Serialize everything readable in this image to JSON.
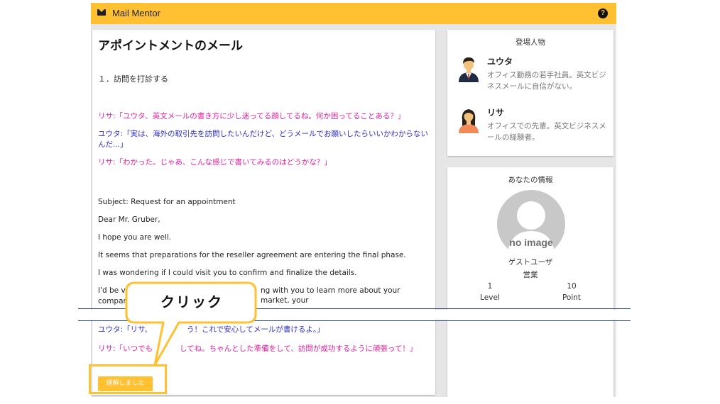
{
  "header": {
    "title": "Mail Mentor",
    "help_glyph": "?"
  },
  "main": {
    "title": "アポイントメントのメール",
    "section": "１．訪問を打診する",
    "dialogue_top": [
      {
        "speaker": "risa",
        "text": "リサ:「ユウタ、英文メールの書き方に少し迷ってる顔してるね。何か困ってることある？」"
      },
      {
        "speaker": "yuta",
        "text": "ユウタ:「実は、海外の取引先を訪問したいんだけど、どうメールでお願いしたらいいかわからないんだ...」"
      },
      {
        "speaker": "risa",
        "text": "リサ:「わかった。じゃあ、こんな感じで書いてみるのはどうかな？」"
      }
    ],
    "email_lines": [
      "Subject: Request for an appointment",
      "Dear Mr. Gruber,",
      "I hope you are well.",
      "It seems that preparations for the reseller agreement are entering the final phase.",
      "I was wondering if I could visit you to confirm and finalize the details.",
      "I'd be very",
      "ng with you to learn more about your market, your",
      "company"
    ],
    "dialogue_bottom": [
      {
        "speaker": "yuta",
        "text": "ユウタ:「リサ、",
        "rest": "う！これで安心してメールが書けるよ。」"
      },
      {
        "speaker": "risa",
        "text": "リサ:「いつでも",
        "rest": "してね。ちゃんとした準備をして、訪問が成功するように頑張って！」"
      }
    ],
    "understood_label": "理解しました"
  },
  "characters": {
    "heading": "登場人物",
    "items": [
      {
        "name": "ユウタ",
        "desc": "オフィス勤務の若手社員。英文ビジネスメールに自信がない。"
      },
      {
        "name": "リサ",
        "desc": "オフィスでの先輩。英文ビジネスメールの経験者。"
      }
    ]
  },
  "profile": {
    "heading": "あなたの情報",
    "no_image": "no image",
    "user_name": "ゲストユーザ",
    "department": "営業",
    "level_value": "1",
    "level_label": "Level",
    "point_value": "10",
    "point_label": "Point"
  },
  "callout": {
    "text": "クリック"
  },
  "colors": {
    "accent": "#ffc132",
    "risa": "#e0219a",
    "yuta": "#2d2fc9",
    "rule": "#2e4f86"
  }
}
